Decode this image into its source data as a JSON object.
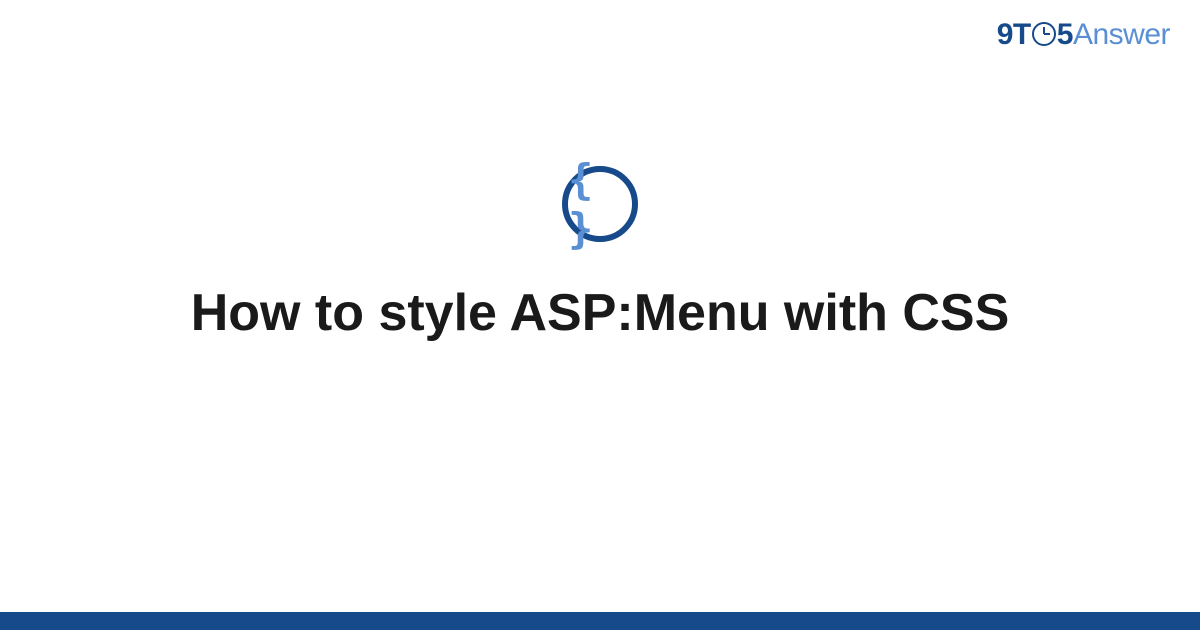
{
  "brand": {
    "part1": "9T",
    "part2": "5",
    "part3": "Answer"
  },
  "category_icon": {
    "symbol": "{ }",
    "name": "code-braces"
  },
  "title": "How to style ASP:Menu with CSS",
  "colors": {
    "primary": "#164a8a",
    "secondary": "#5a8fd4",
    "text": "#1a1a1a"
  }
}
